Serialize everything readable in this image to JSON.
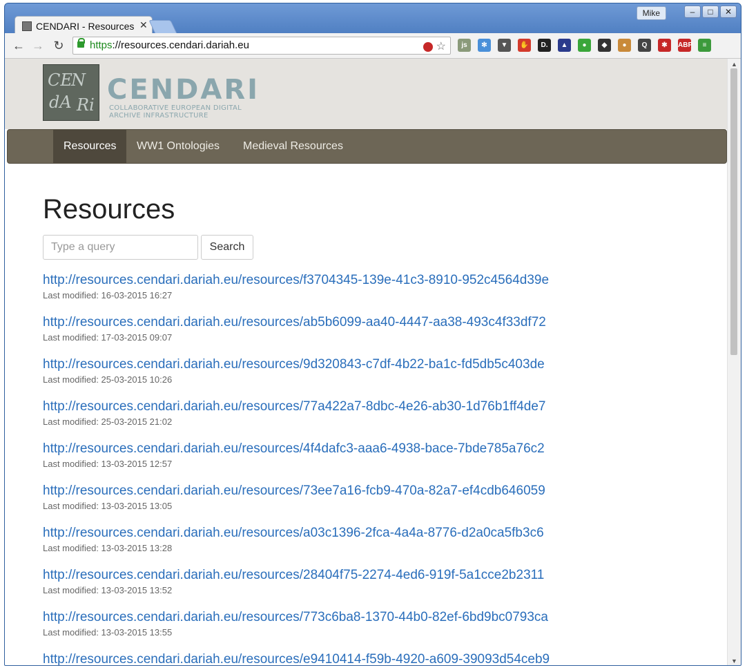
{
  "browser": {
    "tab_title": "CENDARI - Resources",
    "tab_close": "✕",
    "user_name": "Mike",
    "url_scheme": "https",
    "url_rest": "://resources.cendari.dariah.eu",
    "back_icon": "←",
    "forward_icon": "→",
    "reload_icon": "↻",
    "star_icon": "☆",
    "menu_icon": "≡",
    "extensions": [
      {
        "name": "js-icon",
        "label": "js",
        "color": "#8a9a7a"
      },
      {
        "name": "pocket-like-icon",
        "label": "✻",
        "color": "#4a90d9"
      },
      {
        "name": "pocket-icon",
        "label": "▼",
        "color": "#555555"
      },
      {
        "name": "stop-hand-icon",
        "label": "✋",
        "color": "#d33b2c"
      },
      {
        "name": "d-icon",
        "label": "D.",
        "color": "#222222"
      },
      {
        "name": "chart-icon",
        "label": "▲",
        "color": "#2b3b8c"
      },
      {
        "name": "leaf-icon",
        "label": "●",
        "color": "#3aa63a"
      },
      {
        "name": "mask-icon",
        "label": "◆",
        "color": "#333333"
      },
      {
        "name": "cookie-icon",
        "label": "●",
        "color": "#c98a3a"
      },
      {
        "name": "magnifier-icon",
        "label": "Q",
        "color": "#444444"
      },
      {
        "name": "asterisk-icon",
        "label": "✱",
        "color": "#c62828"
      },
      {
        "name": "adblock-icon",
        "label": "ABP",
        "color": "#c62828"
      },
      {
        "name": "menu-icon",
        "label": "≡",
        "color": "#3c9a3c"
      }
    ]
  },
  "site": {
    "logo_title": "CENDARI",
    "logo_subtitle": "Collaborative European Digital Archive Infrastructure",
    "nav": [
      {
        "label": "Resources",
        "active": true
      },
      {
        "label": "WW1 Ontologies",
        "active": false
      },
      {
        "label": "Medieval Resources",
        "active": false
      }
    ]
  },
  "main": {
    "title": "Resources",
    "search": {
      "placeholder": "Type a query",
      "value": "",
      "button_label": "Search"
    },
    "results": [
      {
        "url": "http://resources.cendari.dariah.eu/resources/f3704345-139e-41c3-8910-952c4564d39e",
        "meta": "Last modified: 16-03-2015 16:27"
      },
      {
        "url": "http://resources.cendari.dariah.eu/resources/ab5b6099-aa40-4447-aa38-493c4f33df72",
        "meta": "Last modified: 17-03-2015 09:07"
      },
      {
        "url": "http://resources.cendari.dariah.eu/resources/9d320843-c7df-4b22-ba1c-fd5db5c403de",
        "meta": "Last modified: 25-03-2015 10:26"
      },
      {
        "url": "http://resources.cendari.dariah.eu/resources/77a422a7-8dbc-4e26-ab30-1d76b1ff4de7",
        "meta": "Last modified: 25-03-2015 21:02"
      },
      {
        "url": "http://resources.cendari.dariah.eu/resources/4f4dafc3-aaa6-4938-bace-7bde785a76c2",
        "meta": "Last modified: 13-03-2015 12:57"
      },
      {
        "url": "http://resources.cendari.dariah.eu/resources/73ee7a16-fcb9-470a-82a7-ef4cdb646059",
        "meta": "Last modified: 13-03-2015 13:05"
      },
      {
        "url": "http://resources.cendari.dariah.eu/resources/a03c1396-2fca-4a4a-8776-d2a0ca5fb3c6",
        "meta": "Last modified: 13-03-2015 13:28"
      },
      {
        "url": "http://resources.cendari.dariah.eu/resources/28404f75-2274-4ed6-919f-5a1cce2b2311",
        "meta": "Last modified: 13-03-2015 13:52"
      },
      {
        "url": "http://resources.cendari.dariah.eu/resources/773c6ba8-1370-44b0-82ef-6bd9bc0793ca",
        "meta": "Last modified: 13-03-2015 13:55"
      },
      {
        "url": "http://resources.cendari.dariah.eu/resources/e9410414-f59b-4920-a609-39093d54ceb9",
        "meta": ""
      }
    ]
  }
}
